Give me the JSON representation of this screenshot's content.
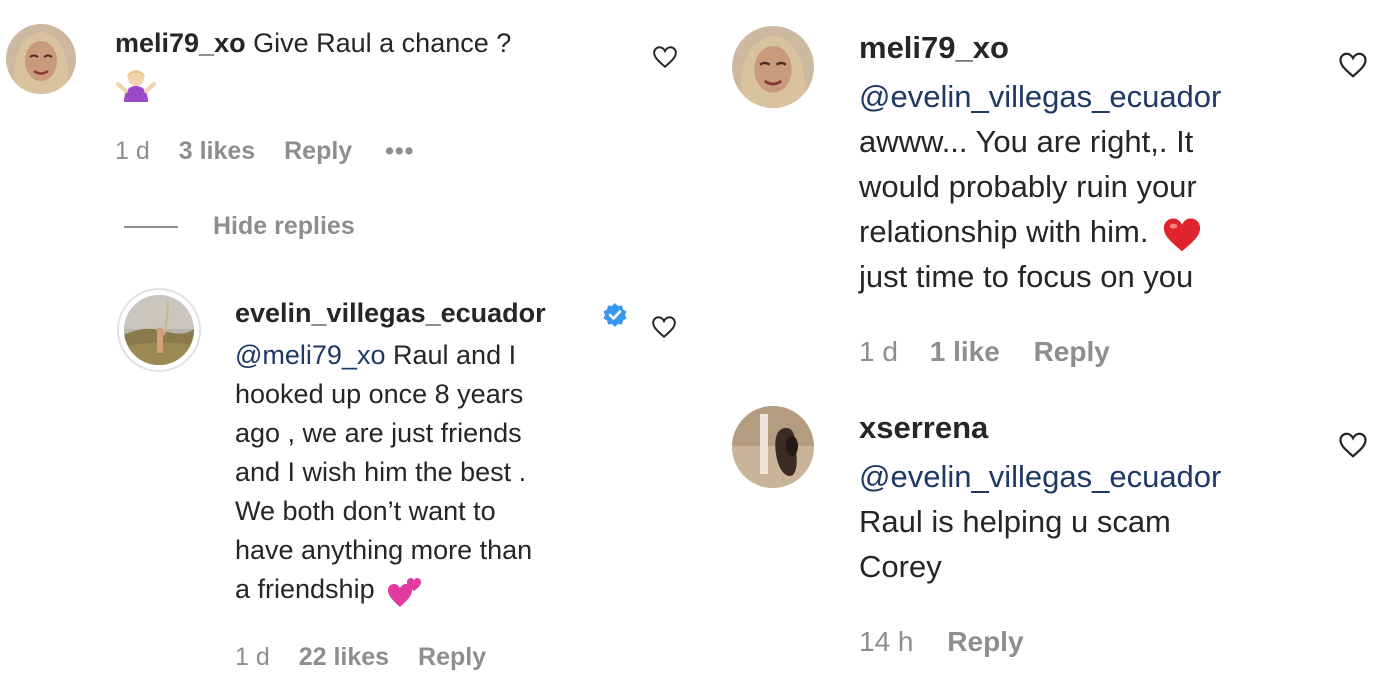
{
  "left": {
    "top_comment": {
      "username": "meli79_xo",
      "text": "Give Raul a chance ?",
      "emoji": "person-shrugging-emoji",
      "time": "1 d",
      "likes": "3 likes",
      "reply": "Reply",
      "more": "•••"
    },
    "hide_replies": "Hide replies",
    "reply_comment": {
      "username": "evelin_villegas_ecuador",
      "verified": true,
      "mention": "@meli79_xo",
      "lines": [
        "Raul and I",
        "hooked up once 8 years",
        "ago , we are just friends",
        "and I wish him the best .",
        "We both don’t want to",
        "have anything more than",
        "a friendship"
      ],
      "emoji": "two-hearts-emoji",
      "time": "1 d",
      "likes": "22 likes",
      "reply": "Reply"
    }
  },
  "right": {
    "comment_1": {
      "username": "meli79_xo",
      "mention": "@evelin_villegas_ecuador",
      "lines": [
        "awww... You are right,. It",
        "would probably ruin your",
        "relationship with him.",
        "just time to focus on you"
      ],
      "emoji": "red-heart-emoji",
      "time": "1 d",
      "likes": "1 like",
      "reply": "Reply"
    },
    "comment_2": {
      "username": "xserrena",
      "mention": "@evelin_villegas_ecuador",
      "lines": [
        "Raul is helping u scam",
        "Corey"
      ],
      "time": "14 h",
      "reply": "Reply"
    }
  },
  "colors": {
    "text": "#262626",
    "secondary": "#8e8e8e",
    "mention": "#1e3a64",
    "verified": "#3897f0"
  }
}
